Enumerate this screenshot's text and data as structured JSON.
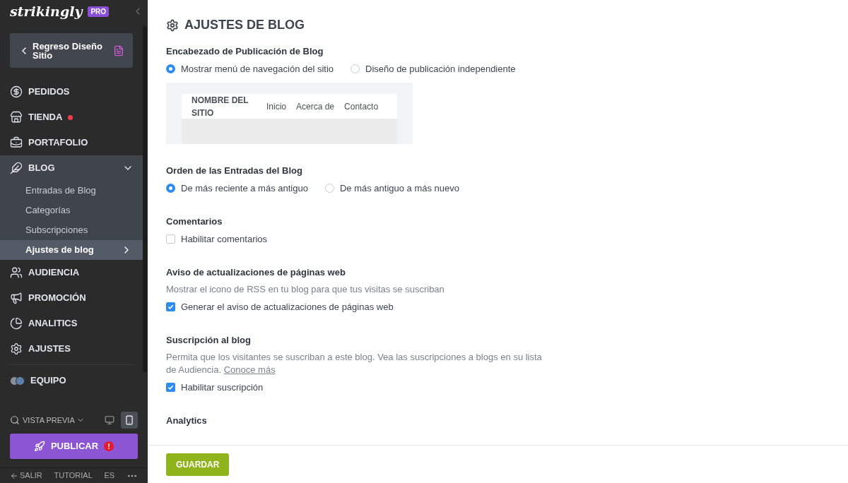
{
  "sidebar": {
    "logo": "strikingly",
    "plan_badge": "PRO",
    "back_button": "Regreso Diseño Sitio",
    "items": [
      {
        "label": "PEDIDOS"
      },
      {
        "label": "TIENDA",
        "dot": true
      },
      {
        "label": "PORTAFOLIO"
      },
      {
        "label": "BLOG",
        "expanded": true,
        "children": [
          {
            "label": "Entradas de Blog",
            "selected": false
          },
          {
            "label": "Categorías",
            "selected": false
          },
          {
            "label": "Subscripciones",
            "selected": false
          },
          {
            "label": "Ajustes de blog",
            "selected": true
          }
        ]
      },
      {
        "label": "AUDIENCIA"
      },
      {
        "label": "PROMOCIÓN"
      },
      {
        "label": "ANALITICS"
      },
      {
        "label": "AJUSTES"
      }
    ],
    "team": "EQUIPO",
    "preview": "VISTA PREVIA",
    "devices": [
      {
        "kind": "desktop",
        "selected": false
      },
      {
        "kind": "mobile",
        "selected": true
      }
    ],
    "publish_button": "PUBLICAR",
    "publish_alert": "!",
    "footer_links": [
      "SALIR",
      "TUTORIAL",
      "ES"
    ]
  },
  "main": {
    "title": "AJUSTES DE BLOG",
    "sections": [
      {
        "heading": "Encabezado de Publicación de Blog",
        "kind": "radio",
        "options": [
          {
            "label": "Mostrar menú de navegación del sitio",
            "selected": true
          },
          {
            "label": "Diseño de publicación independiente",
            "selected": false
          }
        ],
        "preview": {
          "site_name": "NOMBRE DEL SITIO",
          "links": [
            "Inicio",
            "Acerca de",
            "Contacto"
          ]
        }
      },
      {
        "heading": "Orden de las Entradas del Blog",
        "kind": "radio",
        "options": [
          {
            "label": "De más reciente a más antiguo",
            "selected": true
          },
          {
            "label": "De más antiguo a más nuevo",
            "selected": false
          }
        ]
      },
      {
        "heading": "Comentarios",
        "kind": "checkbox",
        "options": [
          {
            "label": "Habilitar comentarios",
            "checked": false
          }
        ]
      },
      {
        "heading": "Aviso de actualizaciones de páginas web",
        "description": "Mostrar el icono de RSS en tu blog para que tus visitas se suscriban",
        "kind": "checkbox",
        "options": [
          {
            "label": "Generar el aviso de actualizaciones de páginas web",
            "checked": true
          }
        ]
      },
      {
        "heading": "Suscripción al blog",
        "description": "Permita que los visitantes se suscriban a este blog. Vea las suscripciones a blogs en su lista de Audiencia.",
        "link": "Conoce más",
        "kind": "checkbox",
        "options": [
          {
            "label": "Habilitar suscripción",
            "checked": true
          }
        ]
      },
      {
        "heading": "Analytics"
      }
    ],
    "save_button": "GUARDAR"
  }
}
